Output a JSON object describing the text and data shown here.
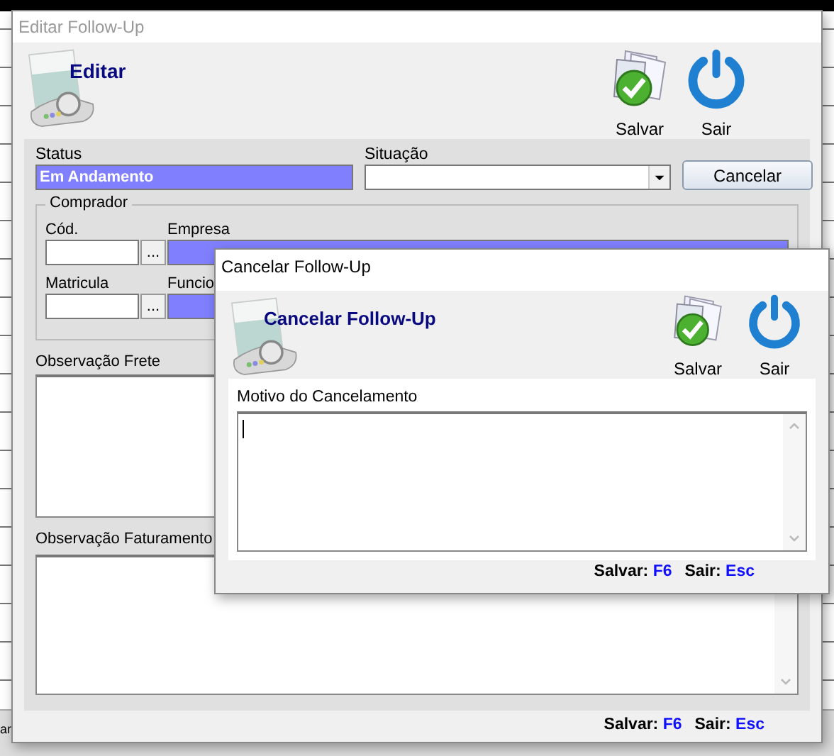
{
  "background_fragment": "ar",
  "main_window": {
    "title": "Editar Follow-Up",
    "header_title": "Editar",
    "toolbar": [
      {
        "kind": "save",
        "label": "Salvar"
      },
      {
        "kind": "exit",
        "label": "Sair"
      }
    ],
    "status": {
      "label": "Status",
      "value": "Em Andamento"
    },
    "situacao": {
      "label": "Situação"
    },
    "cancel_button": "Cancelar",
    "comprador": {
      "title": "Comprador",
      "rows": [
        {
          "code_label": "Cód.",
          "name_label": "Empresa"
        },
        {
          "code_label": "Matricula",
          "name_label": "Funcio"
        }
      ],
      "lookup_button": "..."
    },
    "obs_frete": {
      "label": "Observação Frete"
    },
    "obs_faturamento": {
      "label": "Observação Faturamento"
    },
    "shortcuts": [
      {
        "label": "Salvar:",
        "key": "F6"
      },
      {
        "label": "Sair:",
        "key": "Esc"
      }
    ]
  },
  "dialog": {
    "title": "Cancelar Follow-Up",
    "header_title": "Cancelar Follow-Up",
    "toolbar": [
      {
        "kind": "save",
        "label": "Salvar"
      },
      {
        "kind": "exit",
        "label": "Sair"
      }
    ],
    "motivo": {
      "label": "Motivo do Cancelamento"
    },
    "shortcuts": [
      {
        "label": "Salvar:",
        "key": "F6"
      },
      {
        "label": "Sair:",
        "key": "Esc"
      }
    ]
  }
}
